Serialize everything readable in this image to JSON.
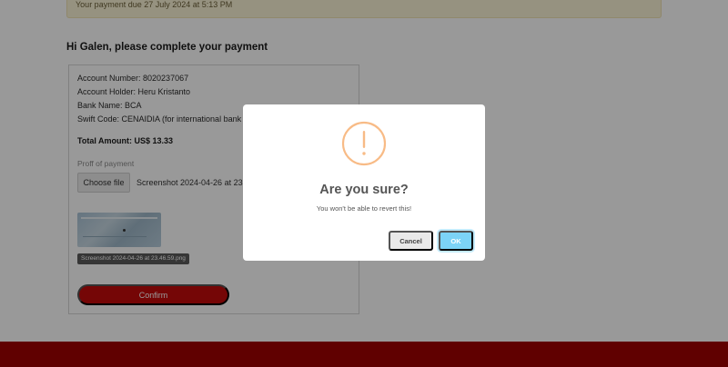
{
  "banner": {
    "due_text": "Your payment due 27 July 2024 at 5:13 PM"
  },
  "greeting": "Hi Galen, please complete your payment",
  "account": {
    "number": "Account Number: 8020237067",
    "holder": "Account Holder: Heru Kristanto",
    "bank": "Bank Name: BCA",
    "swift": "Swift Code: CENAIDIA (for international bank tr"
  },
  "total_amount": "Total Amount: US$ 13.33",
  "proof": {
    "label": "Proff of payment",
    "choose_label": "Choose file",
    "file_name": "Screenshot 2024-04-26 at 23.46",
    "chip_name": "Screenshot 2024-04-26 at 23.46.59.png"
  },
  "confirm_label": "Confirm",
  "modal": {
    "icon": "warning-icon",
    "title": "Are you sure?",
    "text": "You won't be able to revert this!",
    "cancel_label": "Cancel",
    "ok_label": "OK"
  },
  "colors": {
    "primary_red": "#c30a0a",
    "footer_red": "#a00000",
    "warning_orange": "#f8bb86",
    "ok_blue": "#7cd3f7",
    "banner_yellow": "#fbf3d6"
  }
}
